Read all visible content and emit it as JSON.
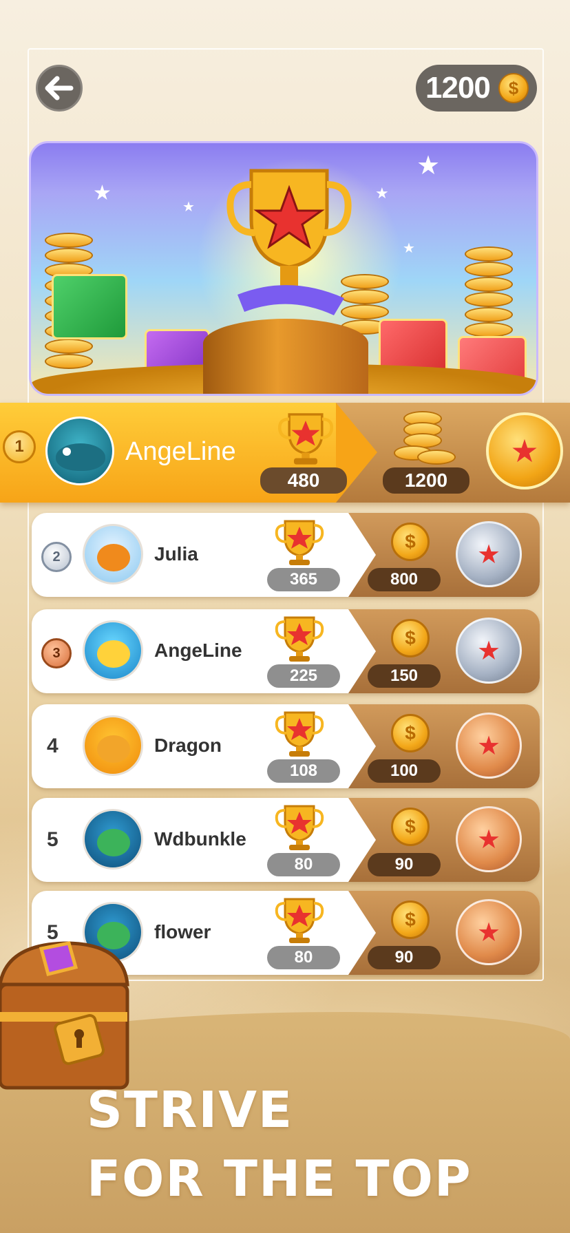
{
  "header": {
    "back_icon": "arrow-left-icon",
    "coin_balance": "1200",
    "coin_icon": "dollar-coin-icon"
  },
  "banner": {
    "image": "trophy-with-coins-and-gifts"
  },
  "leaderboard": {
    "top": {
      "rank": "1",
      "name": "AngeLine",
      "avatar": "whale",
      "score": "480",
      "reward": "1200",
      "badge": "gold-trophy-badge"
    },
    "rows": [
      {
        "rank": "2",
        "rank_style": "silver-medal",
        "name": "Julia",
        "avatar": "chicken",
        "score": "365",
        "reward": "800",
        "badge": "silver-trophy-badge"
      },
      {
        "rank": "3",
        "rank_style": "bronze-medal",
        "name": "AngeLine",
        "avatar": "duck",
        "score": "225",
        "reward": "150",
        "badge": "silver-trophy-badge"
      },
      {
        "rank": "4",
        "rank_style": "number",
        "name": "Dragon",
        "avatar": "cat",
        "score": "108",
        "reward": "100",
        "badge": "bronze-trophy-badge"
      },
      {
        "rank": "5",
        "rank_style": "number",
        "name": "Wdbunkle",
        "avatar": "turtle",
        "score": "80",
        "reward": "90",
        "badge": "bronze-trophy-badge"
      },
      {
        "rank": "5",
        "rank_style": "number",
        "name": "flower",
        "avatar": "turtle",
        "score": "80",
        "reward": "90",
        "badge": "bronze-trophy-badge"
      }
    ]
  },
  "tagline": {
    "line1": "STRIVE",
    "line2": "FOR THE TOP"
  },
  "colors": {
    "top_row": "#f7a417",
    "reward_panel": "#b47a3c",
    "score_pill": "#8f8f8f",
    "reward_pill": "#5b3a1d"
  }
}
